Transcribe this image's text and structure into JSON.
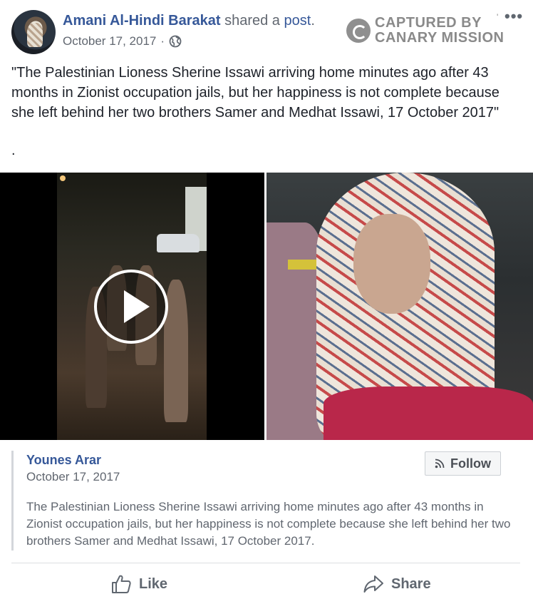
{
  "post": {
    "author": "Amani Al-Hindi Barakat",
    "shared_text": "shared a",
    "shared_object": "post",
    "shared_suffix": ".",
    "date": "October 17, 2017",
    "separator": "·",
    "privacy_icon": "globe-icon",
    "text": "\"The Palestinian Lioness Sherine Issawi arriving home minutes ago after 43 months in Zionist occupation jails, but her happiness is not complete because she left behind her two brothers Samer and Medhat Issawi, 17 October 2017\"",
    "trailing_dot": "."
  },
  "watermark": {
    "line1": "CAPTURED BY",
    "line2": "CANARY MISSION",
    "tick": "'"
  },
  "menu": {
    "more_label": "•••"
  },
  "media": {
    "video_icon": "play-icon",
    "photo_icon": "photo"
  },
  "original_post": {
    "author": "Younes Arar",
    "date": "October 17, 2017",
    "follow_label": "Follow",
    "text": "The Palestinian Lioness Sherine Issawi arriving home minutes ago after 43 months in Zionist occupation jails, but her happiness is not complete because she left behind her two brothers Samer and Medhat Issawi, 17 October 2017."
  },
  "actions": {
    "like_label": "Like",
    "share_label": "Share"
  },
  "colors": {
    "link_blue": "#365899",
    "meta_gray": "#616770",
    "watermark_gray": "#8a8a8a"
  }
}
